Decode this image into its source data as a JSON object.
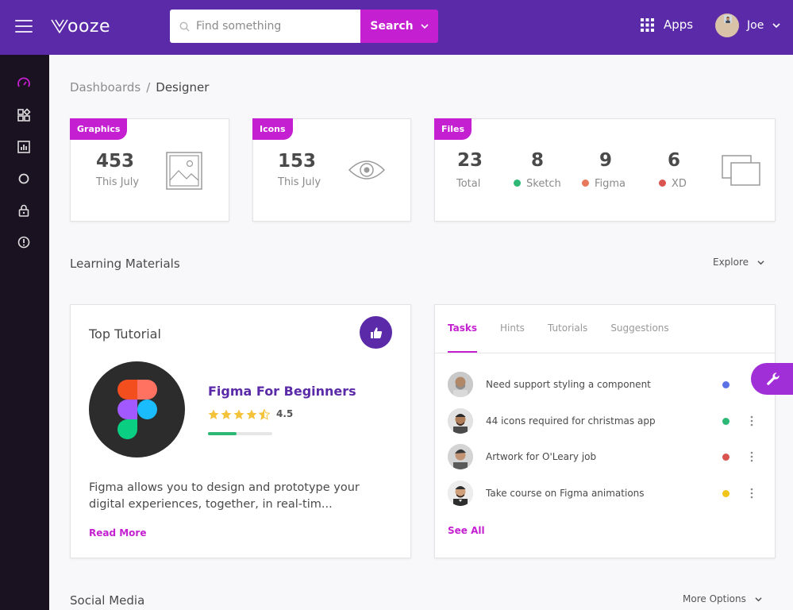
{
  "brand": {
    "name": "ooze"
  },
  "search": {
    "placeholder": "Find something",
    "button_label": "Search"
  },
  "header": {
    "apps_label": "Apps",
    "user_name": "Joe"
  },
  "breadcrumb": {
    "parent": "Dashboards",
    "separator": "/",
    "current": "Designer"
  },
  "stats": {
    "graphics": {
      "tag": "Graphics",
      "value": "453",
      "sub": "This July"
    },
    "icons": {
      "tag": "Icons",
      "value": "153",
      "sub": "This July"
    },
    "files": {
      "tag": "Files",
      "items": [
        {
          "value": "23",
          "label": "Total",
          "color": ""
        },
        {
          "value": "8",
          "label": "Sketch",
          "color": "#2eb876"
        },
        {
          "value": "9",
          "label": "Figma",
          "color": "#e8785b"
        },
        {
          "value": "6",
          "label": "XD",
          "color": "#d9534f"
        }
      ]
    }
  },
  "learning": {
    "title": "Learning Materials",
    "link": "Explore"
  },
  "tutorial": {
    "heading": "Top Tutorial",
    "course_title": "Figma For Beginners",
    "rating": "4.5",
    "rating_value": 4.5,
    "progress": 0.45,
    "description": "Figma allows you to design and prototype your digital experiences, together, in real-tim...",
    "read_more": "Read More"
  },
  "tasks": {
    "tabs": [
      "Tasks",
      "Hints",
      "Tutorials",
      "Suggestions"
    ],
    "items": [
      {
        "text": "Need support styling a component",
        "status_color": "#5b72e6"
      },
      {
        "text": "44 icons required for christmas app",
        "status_color": "#2eb876"
      },
      {
        "text": "Artwork for O'Leary job",
        "status_color": "#d9534f"
      },
      {
        "text": "Take course on Figma animations",
        "status_color": "#f0c419"
      }
    ],
    "see_all": "See All"
  },
  "social": {
    "title": "Social Media",
    "link": "More Options"
  },
  "colors": {
    "topbar": "#5b2aa8",
    "accent": "#c41fd1",
    "sidebar": "#1a1221",
    "primary_text": "#5b2aa8"
  }
}
